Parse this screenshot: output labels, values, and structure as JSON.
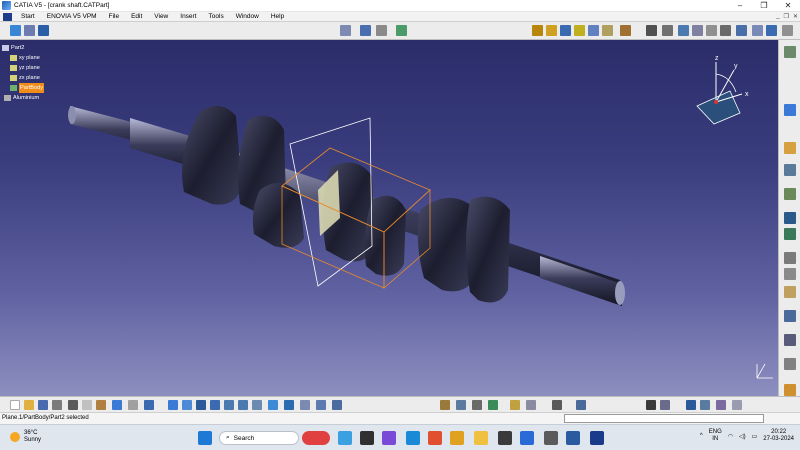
{
  "window": {
    "title": "CATIA V5 - [crank shaft.CATPart]"
  },
  "menubar": {
    "items": [
      "Start",
      "ENOVIA V5 VPM",
      "File",
      "Edit",
      "View",
      "Insert",
      "Tools",
      "Window",
      "Help"
    ]
  },
  "tree": {
    "root": "Part2",
    "items": [
      "xy plane",
      "yz plane",
      "zx plane",
      "PartBody",
      "Aluminium"
    ],
    "selected": "PartBody"
  },
  "compass": {
    "x_label": "x",
    "y_label": "y",
    "z_label": "z"
  },
  "status": {
    "message": "Plane.1/PartBody/Part2 selected"
  },
  "taskbar": {
    "weather_temp": "36°C",
    "weather_desc": "Sunny",
    "search_placeholder": "Search",
    "lang_line1": "ENG",
    "lang_line2": "IN",
    "time": "20:22",
    "date": "27-03-2024"
  },
  "colors": {
    "viewport_top": "#2b2d6a",
    "viewport_bottom": "#8d8fc0",
    "selection": "#f08c1a",
    "titlebar": "#ffffff"
  }
}
